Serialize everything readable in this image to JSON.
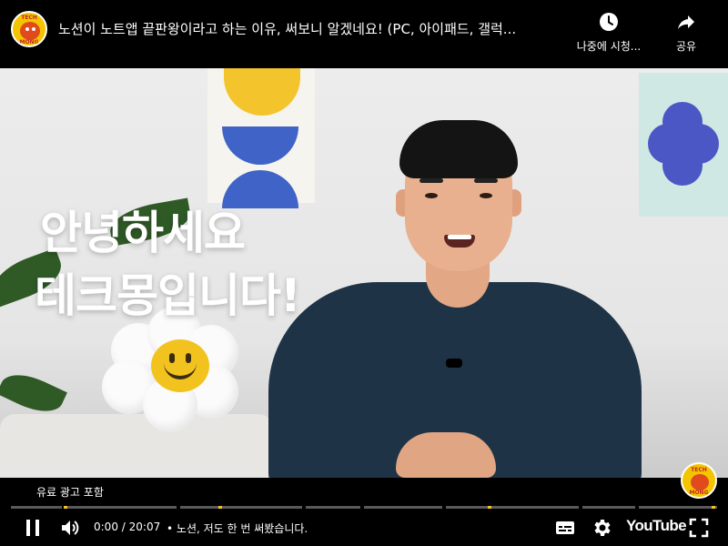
{
  "header": {
    "title": "노션이 노트앱 끝판왕이라고 하는 이유, 써보니 알겠네요! (PC, 아이패드, 갤럭...",
    "channel_logo_text_top": "TECH",
    "channel_logo_text_bottom": "MONG",
    "watch_later_label": "나중에 시청...",
    "share_label": "공유"
  },
  "video": {
    "overlay_line_1": "안녕하세요",
    "overlay_line_2": "테크몽입니다!"
  },
  "player": {
    "paid_promotion_label": "유료 광고 포함",
    "time_current": "0:00",
    "time_separator": " / ",
    "time_duration": "20:07",
    "chapter_separator": "•",
    "chapter_title": "노션, 저도 한 번 써봤습니다.",
    "progress_fraction": 0,
    "logo_text": "YouTube",
    "watermark_text_top": "TECH",
    "watermark_text_bottom": "MONG"
  },
  "icons": {
    "watch_later": "clock-icon",
    "share": "share-arrow-icon",
    "play_pause": "pause-icon",
    "volume": "volume-icon",
    "subtitles": "subtitles-icon",
    "settings": "gear-icon",
    "fullscreen": "fullscreen-icon"
  },
  "colors": {
    "ad_marker": "#f2c21e",
    "brand_yellow": "#f5c400"
  }
}
